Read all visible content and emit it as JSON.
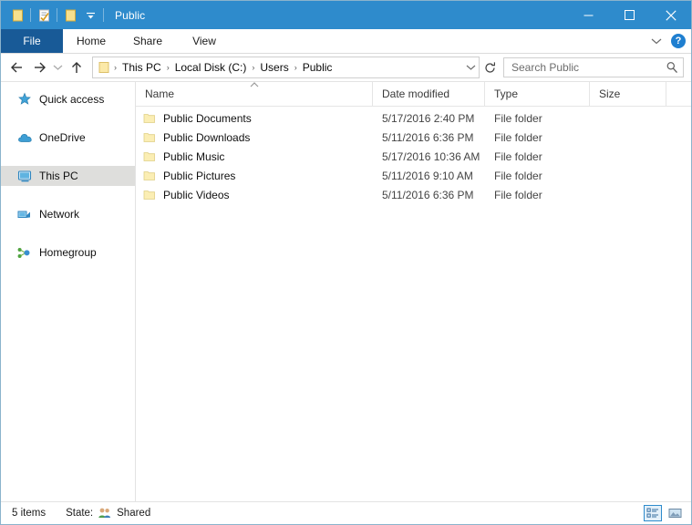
{
  "window": {
    "title": "Public",
    "quick_access": [
      "folder-icon",
      "properties-icon",
      "new-folder-icon",
      "customize-dropdown-icon"
    ],
    "controls": {
      "minimize": "–",
      "maximize": "□",
      "close": "✕"
    }
  },
  "ribbon": {
    "tabs": [
      {
        "label": "File",
        "id": "file"
      },
      {
        "label": "Home",
        "id": "home"
      },
      {
        "label": "Share",
        "id": "share"
      },
      {
        "label": "View",
        "id": "view"
      }
    ],
    "expand_icon": "chevron-down-icon",
    "help_label": "?"
  },
  "address": {
    "back_icon": "←",
    "forward_icon": "→",
    "recent_icon": "⌄",
    "up_icon": "↑",
    "breadcrumbs": [
      "This PC",
      "Local Disk (C:)",
      "Users",
      "Public"
    ],
    "separator": "›",
    "dropdown_icon": "chevron-down-icon",
    "refresh_icon": "refresh-icon"
  },
  "search": {
    "placeholder": "Search Public",
    "icon": "search-icon"
  },
  "sidebar": {
    "items": [
      {
        "label": "Quick access",
        "icon": "star-icon",
        "selected": false
      },
      {
        "label": "OneDrive",
        "icon": "cloud-icon",
        "selected": false
      },
      {
        "label": "This PC",
        "icon": "monitor-icon",
        "selected": true
      },
      {
        "label": "Network",
        "icon": "network-icon",
        "selected": false
      },
      {
        "label": "Homegroup",
        "icon": "homegroup-icon",
        "selected": false
      }
    ]
  },
  "filelist": {
    "columns": [
      {
        "label": "Name",
        "key": "name",
        "sorted": "ascending"
      },
      {
        "label": "Date modified",
        "key": "date"
      },
      {
        "label": "Type",
        "key": "type"
      },
      {
        "label": "Size",
        "key": "size"
      }
    ],
    "rows": [
      {
        "name": "Public Documents",
        "date": "5/17/2016 2:40 PM",
        "type": "File folder",
        "size": ""
      },
      {
        "name": "Public Downloads",
        "date": "5/11/2016 6:36 PM",
        "type": "File folder",
        "size": ""
      },
      {
        "name": "Public Music",
        "date": "5/17/2016 10:36 AM",
        "type": "File folder",
        "size": ""
      },
      {
        "name": "Public Pictures",
        "date": "5/11/2016 9:10 AM",
        "type": "File folder",
        "size": ""
      },
      {
        "name": "Public Videos",
        "date": "5/11/2016 6:36 PM",
        "type": "File folder",
        "size": ""
      }
    ]
  },
  "statusbar": {
    "item_count": "5 items",
    "state_label": "State:",
    "state_value": "Shared",
    "state_icon": "people-icon",
    "views": [
      {
        "name": "details-view",
        "active": true
      },
      {
        "name": "large-icons-view",
        "active": false
      }
    ]
  },
  "colors": {
    "titlebar": "#2e8bcc",
    "file_tab": "#185a97",
    "selection": "#dededc",
    "folder": "#fbe9a8",
    "accent": "#1f7fd0"
  }
}
